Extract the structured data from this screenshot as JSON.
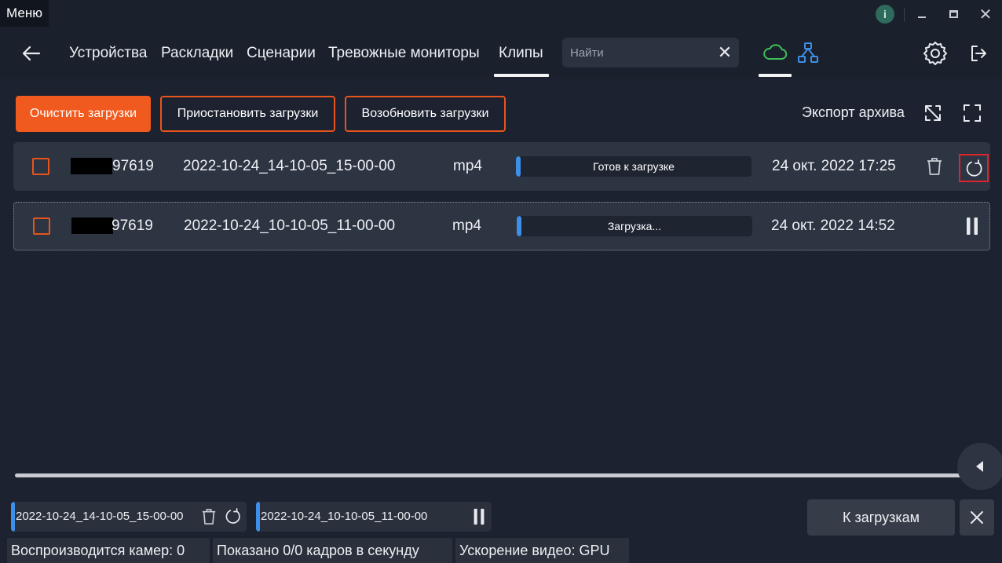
{
  "window": {
    "menu_label": "Меню",
    "info_glyph": "i",
    "close_glyph": "✕"
  },
  "nav": {
    "tabs": [
      {
        "label": "Устройства"
      },
      {
        "label": "Раскладки"
      },
      {
        "label": "Сценарии"
      },
      {
        "label": "Тревожные мониторы"
      },
      {
        "label": "Клипы",
        "active": true
      }
    ],
    "search_placeholder": "Найти",
    "search_clear_glyph": "✕"
  },
  "toolbar": {
    "clear_label": "Очистить загрузки",
    "pause_label": "Приостановить загрузки",
    "resume_label": "Возобновить загрузки",
    "export_label": "Экспорт архива"
  },
  "clips": [
    {
      "camera_id": "97619",
      "name": "2022-10-24_14-10-05_15-00-00",
      "format": "mp4",
      "status": "Готов к загрузке",
      "progress": 0.01,
      "date": "24 окт. 2022 17:25",
      "state": "ready"
    },
    {
      "camera_id": "97619",
      "name": "2022-10-24_10-10-05_11-00-00",
      "format": "mp4",
      "status": "Загрузка...",
      "progress": 0.01,
      "date": "24 окт. 2022 14:52",
      "state": "downloading"
    }
  ],
  "download_chips": [
    {
      "name": "2022-10-24_14-10-05_15-00-00"
    },
    {
      "name": "2022-10-24_10-10-05_11-00-00"
    }
  ],
  "footer": {
    "to_downloads_label": "К загрузкам",
    "status_cameras": "Воспроизводится камер: 0",
    "status_fps": "Показано 0/0 кадров в секунду",
    "status_accel": "Ускорение видео: GPU"
  },
  "colors": {
    "accent": "#f05a1e",
    "progress": "#3d8fe8",
    "highlight": "#e0242c",
    "cloud": "#3fbf5a",
    "network": "#3d8fe8"
  }
}
